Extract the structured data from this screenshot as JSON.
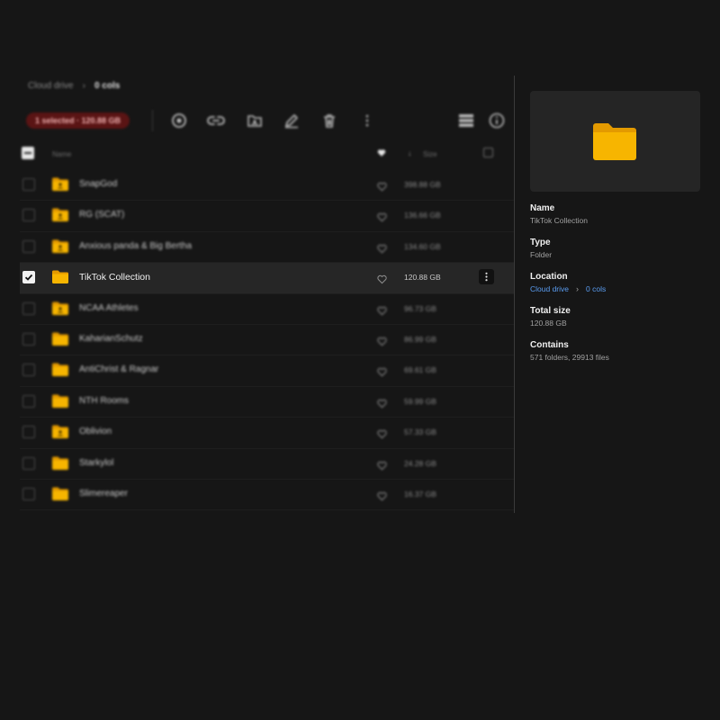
{
  "breadcrumb": {
    "root": "Cloud drive",
    "current": "0 cols"
  },
  "toolbar": {
    "selection_badge": "1 selected · 120.88 GB"
  },
  "table": {
    "header": {
      "name": "Name",
      "size": "Size"
    },
    "rows": [
      {
        "name": "SnapGod",
        "size": "398.88 GB",
        "shared": true,
        "selected": false
      },
      {
        "name": "RG (SCAT)",
        "size": "136.66 GB",
        "shared": true,
        "selected": false
      },
      {
        "name": "Anxious panda & Big Bertha",
        "size": "134.60 GB",
        "shared": true,
        "selected": false
      },
      {
        "name": "TikTok Collection",
        "size": "120.88 GB",
        "shared": false,
        "selected": true
      },
      {
        "name": "NCAA Athletes",
        "size": "96.73 GB",
        "shared": true,
        "selected": false
      },
      {
        "name": "KaharianSchutz",
        "size": "86.99 GB",
        "shared": false,
        "selected": false
      },
      {
        "name": "AntiChrist & Ragnar",
        "size": "69.61 GB",
        "shared": false,
        "selected": false
      },
      {
        "name": "NTH Rooms",
        "size": "59.99 GB",
        "shared": false,
        "selected": false
      },
      {
        "name": "Oblivion",
        "size": "57.33 GB",
        "shared": true,
        "selected": false
      },
      {
        "name": "Starkylol",
        "size": "24.28 GB",
        "shared": false,
        "selected": false
      },
      {
        "name": "Slimereaper",
        "size": "16.37 GB",
        "shared": false,
        "selected": false
      }
    ]
  },
  "details": {
    "name_label": "Name",
    "name_value": "TikTok Collection",
    "type_label": "Type",
    "type_value": "Folder",
    "location_label": "Location",
    "location_root": "Cloud drive",
    "location_current": "0 cols",
    "size_label": "Total size",
    "size_value": "120.88 GB",
    "contains_label": "Contains",
    "contains_value": "571 folders, 29913 files"
  },
  "colors": {
    "folder": "#f7b500",
    "folder_dark": "#e39a00",
    "accent_link": "#5a9cf0",
    "badge_bg": "#5a1414"
  }
}
